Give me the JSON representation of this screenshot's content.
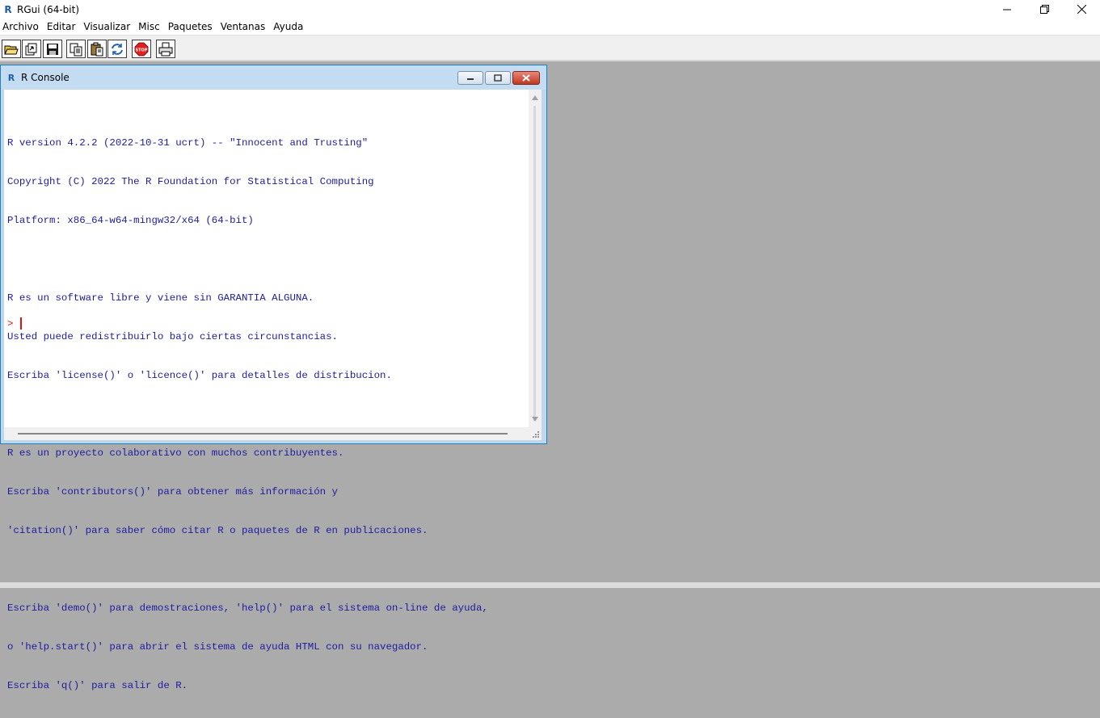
{
  "window": {
    "title": "RGui (64-bit)",
    "icon": "R-logo-icon"
  },
  "menu": {
    "items": [
      "Archivo",
      "Editar",
      "Visualizar",
      "Misc",
      "Paquetes",
      "Ventanas",
      "Ayuda"
    ]
  },
  "toolbar": {
    "buttons": [
      "open-script-icon",
      "load-workspace-icon",
      "save-icon",
      "copy-icon",
      "paste-icon",
      "refresh-icon",
      "stop-icon",
      "print-icon"
    ],
    "stop_label": "STOP"
  },
  "console": {
    "title": "R Console",
    "lines": [
      "R version 4.2.2 (2022-10-31 ucrt) -- \"Innocent and Trusting\"",
      "Copyright (C) 2022 The R Foundation for Statistical Computing",
      "Platform: x86_64-w64-mingw32/x64 (64-bit)",
      "",
      "R es un software libre y viene sin GARANTIA ALGUNA.",
      "Usted puede redistribuirlo bajo ciertas circunstancias.",
      "Escriba 'license()' o 'licence()' para detalles de distribucion.",
      "",
      "R es un proyecto colaborativo con muchos contribuyentes.",
      "Escriba 'contributors()' para obtener más información y",
      "'citation()' para saber cómo citar R o paquetes de R en publicaciones.",
      "",
      "Escriba 'demo()' para demostraciones, 'help()' para el sistema on-line de ayuda,",
      "o 'help.start()' para abrir el sistema de ayuda HTML con su navegador.",
      "Escriba 'q()' para salir de R."
    ],
    "prompt": ">",
    "text_color": "#1c1ca0",
    "prompt_color": "#e01010"
  }
}
